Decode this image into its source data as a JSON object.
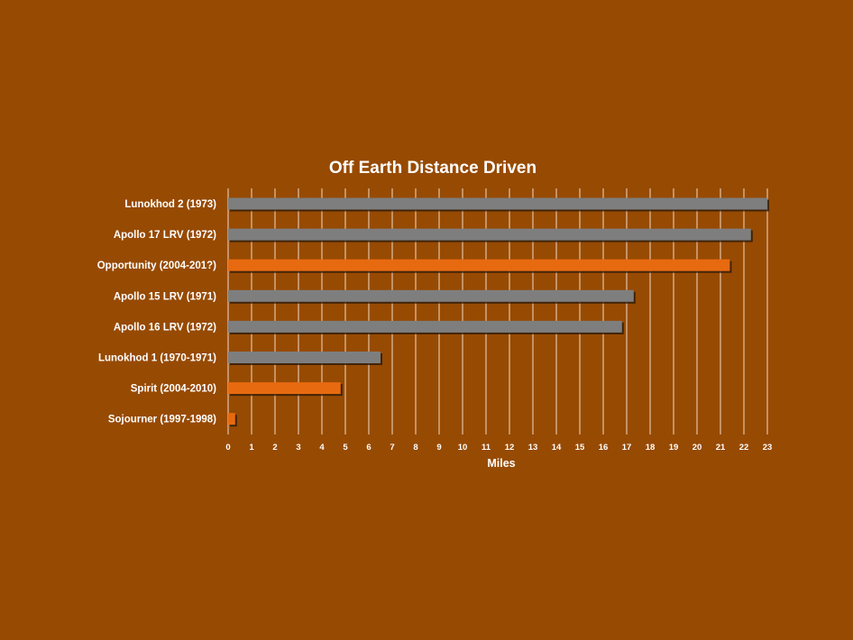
{
  "page": {
    "background": "#974a02"
  },
  "chart_data": {
    "type": "bar",
    "orientation": "horizontal",
    "title": "Off Earth Distance Driven",
    "xlabel": "Miles",
    "ylabel": "",
    "xlim": [
      0,
      23
    ],
    "xticks": [
      0,
      1,
      2,
      3,
      4,
      5,
      6,
      7,
      8,
      9,
      10,
      11,
      12,
      13,
      14,
      15,
      16,
      17,
      18,
      19,
      20,
      21,
      22,
      23
    ],
    "grid": "vertical",
    "legend": "none",
    "categories": [
      "Lunokhod 2 (1973)",
      "Apollo 17 LRV (1972)",
      "Opportunity (2004-201?)",
      "Apollo 15 LRV (1971)",
      "Apollo 16 LRV (1972)",
      "Lunokhod 1 (1970-1971)",
      "Spirit (2004-2010)",
      "Sojourner (1997-1998)"
    ],
    "values": [
      23,
      22.3,
      21.4,
      17.3,
      16.8,
      6.5,
      4.8,
      0.3
    ],
    "bar_colors": [
      "#7e7e7e",
      "#7e7e7e",
      "#e86a10",
      "#7e7e7e",
      "#7e7e7e",
      "#7e7e7e",
      "#e86a10",
      "#e86a10"
    ]
  }
}
